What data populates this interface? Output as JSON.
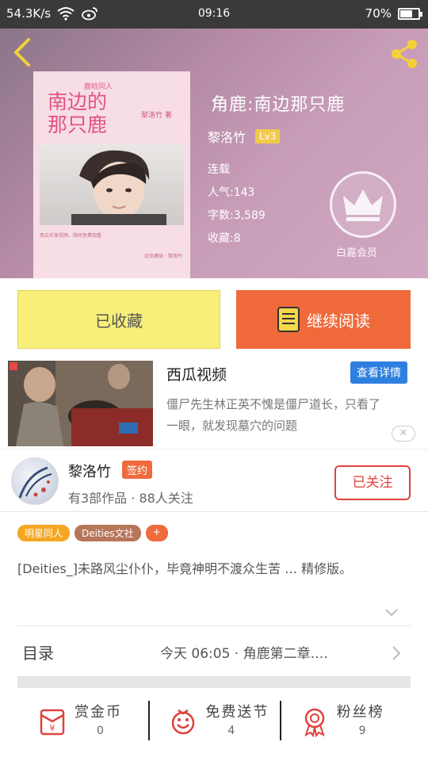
{
  "status_bar": {
    "speed": "54.3K/s",
    "time": "09:16",
    "battery": "70%",
    "battery_level": 0.7
  },
  "book": {
    "cover": {
      "small_tag": "鹿晗同人",
      "title_line1": "南边的",
      "title_line2": "那只鹿",
      "author": "黎洛竹 著",
      "blurb": "西瓜乐享视频，限时免费观看",
      "blurb2": "纪念鹿晗 · 黎洛竹"
    },
    "title": "角鹿:南边那只鹿",
    "author": "黎洛竹",
    "level": "Lv3",
    "status": "连载",
    "popularity": "人气:143",
    "word_count": "字数:3,589",
    "collections": "收藏:8",
    "vip_label": "白嘉会员"
  },
  "actions": {
    "collected_label": "已收藏",
    "continue_label": "继续阅读"
  },
  "ad": {
    "title": "西瓜视频",
    "detail_button": "查看详情",
    "description": "僵尸先生林正英不愧是僵尸道长，只看了一眼，就发现墓穴的问题",
    "close": "✕"
  },
  "author_block": {
    "name": "黎洛竹",
    "signed_badge": "签约",
    "works": "有3部作品 · 88人关注",
    "follow_label": "已关注"
  },
  "tags": [
    {
      "label": "明星同人",
      "color": "#f5a623"
    },
    {
      "label": "Deities文社",
      "color": "#b7765a"
    },
    {
      "label": "+",
      "color": "#ef6a3d"
    }
  ],
  "description": "[Deities_]未路风尘仆仆，毕竟神明不渡众生苦 … 精修版。",
  "catalog": {
    "label": "目录",
    "latest_update": "今天 06:05 · 角鹿第二章.…"
  },
  "bottom_stats": [
    {
      "label": "赏金币",
      "value": "0",
      "icon": "red-envelope-icon"
    },
    {
      "label": "免费送节",
      "value": "4",
      "icon": "gift-icon"
    },
    {
      "label": "粉丝榜",
      "value": "9",
      "icon": "medal-icon"
    }
  ],
  "colors": {
    "accent_orange": "#f0693a",
    "collect_yellow": "#f7ef7a",
    "follow_red": "#e0423c",
    "detail_blue": "#2f7fe0",
    "icon_red": "#e0423c"
  }
}
